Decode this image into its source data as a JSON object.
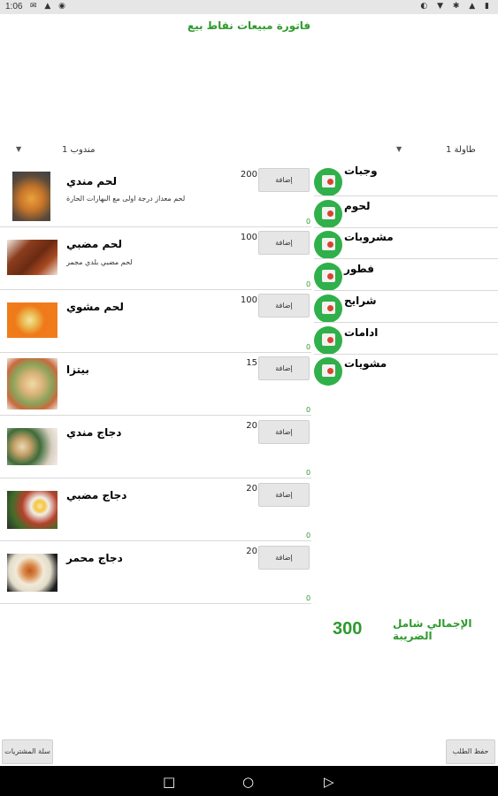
{
  "status_bar": {
    "time": "1:06",
    "left_icons": "✉ ▲ ◉",
    "right_icons": "◐ ▼ ✱ ▲ ▮"
  },
  "title": "فاتورة مبيعات نقاط بيع",
  "dropdowns": {
    "delegate": "مندوب 1",
    "table": "طاولة 1"
  },
  "categories": [
    {
      "label": "وجبات"
    },
    {
      "label": "لحوم"
    },
    {
      "label": "مشروبات"
    },
    {
      "label": "فطور"
    },
    {
      "label": "شرايح"
    },
    {
      "label": "ادامات"
    },
    {
      "label": "مشويات"
    }
  ],
  "items": [
    {
      "name": "لحم مندي",
      "desc": "لحم معداز درجة اولى مع البهارات الحارة",
      "price": "200",
      "add_label": "إضافة",
      "qty": "0"
    },
    {
      "name": "لحم مضبي",
      "desc": "لحم مضبي بلدي مجمر",
      "price": "100",
      "add_label": "إضافة",
      "qty": "0"
    },
    {
      "name": "لحم مشوي",
      "desc": "",
      "price": "100",
      "add_label": "إضافة",
      "qty": "0"
    },
    {
      "name": "بيتزا",
      "desc": "",
      "price": "15",
      "add_label": "إضافة",
      "qty": "0"
    },
    {
      "name": "دجاج مندي",
      "desc": "",
      "price": "20",
      "add_label": "إضافة",
      "qty": "0"
    },
    {
      "name": "دجاج مضبي",
      "desc": "",
      "price": "20",
      "add_label": "إضافة",
      "qty": "0"
    },
    {
      "name": "دجاج محمر",
      "desc": "",
      "price": "20",
      "add_label": "إضافة",
      "qty": "0"
    }
  ],
  "total": {
    "label": "الإجمالي شامل الضريبة",
    "value": "300"
  },
  "buttons": {
    "pending": "سلة المشتريات",
    "save": "حفظ الطلب"
  },
  "colors": {
    "accent": "#2e9a2e",
    "category_circle": "#2fb04a"
  },
  "nav_icons": [
    "square-icon",
    "circle-icon",
    "triangle-icon"
  ]
}
